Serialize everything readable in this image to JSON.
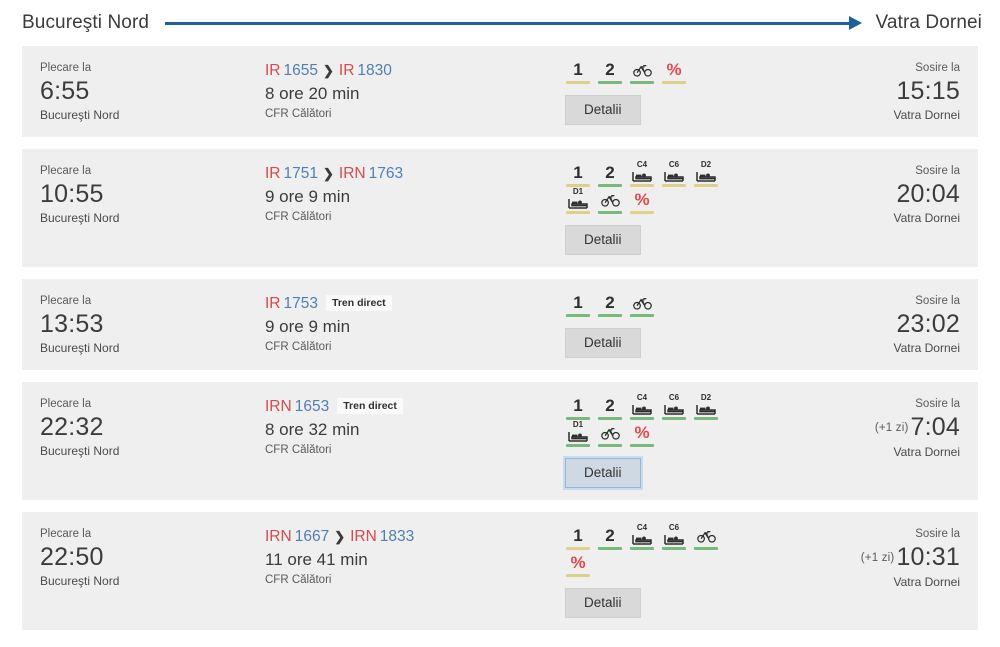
{
  "route": {
    "origin": "Bucureşti Nord",
    "destination": "Vatra Dornei",
    "arrow_color": "#1f5f9e"
  },
  "labels": {
    "depart": "Plecare la",
    "arrive": "Sosire la",
    "details_button": "Detalii",
    "direct_badge": "Tren direct",
    "next_day": "(+1 zi)"
  },
  "colors": {
    "card_bg": "#efefef",
    "page_bg": "#ffffff",
    "train_prefix": "#d84a4a",
    "train_number": "#4f7fb3",
    "percent": "#e24a4a",
    "bar_green": "#79b97e",
    "bar_khaki": "#ddd08a",
    "focus_ring": "#9bb6d4"
  },
  "results": [
    {
      "depart_label": "Plecare la",
      "depart_time": "6:55",
      "depart_station": "Bucureşti Nord",
      "legs": [
        {
          "prefix": "IR",
          "number": "1655"
        },
        {
          "prefix": "IR",
          "number": "1830"
        }
      ],
      "direct": false,
      "duration": "8 ore 20 min",
      "operator": "CFR Călători",
      "amenities": [
        {
          "icon": "class-1",
          "text": "1",
          "bar": "khaki"
        },
        {
          "icon": "class-2",
          "text": "2",
          "bar": "green"
        },
        {
          "icon": "bicycle-icon",
          "text": "",
          "bar": "green"
        },
        {
          "icon": "discount-percent-icon",
          "text": "%",
          "bar": "khaki"
        }
      ],
      "details_button": "Detalii",
      "details_focused": false,
      "arrive_label": "Sosire la",
      "arrive_nextday": "",
      "arrive_time": "15:15",
      "arrive_station": "Vatra Dornei"
    },
    {
      "depart_label": "Plecare la",
      "depart_time": "10:55",
      "depart_station": "Bucureşti Nord",
      "legs": [
        {
          "prefix": "IR",
          "number": "1751"
        },
        {
          "prefix": "IRN",
          "number": "1763"
        }
      ],
      "direct": false,
      "duration": "9 ore 9 min",
      "operator": "CFR Călători",
      "amenities": [
        {
          "icon": "class-1",
          "text": "1",
          "bar": "khaki"
        },
        {
          "icon": "class-2",
          "text": "2",
          "bar": "green"
        },
        {
          "icon": "couchette-c4-icon",
          "text": "C4",
          "bar": "khaki"
        },
        {
          "icon": "couchette-c6-icon",
          "text": "C6",
          "bar": "khaki"
        },
        {
          "icon": "sleeper-d2-icon",
          "text": "D2",
          "bar": "khaki"
        },
        {
          "icon": "sleeper-d1-icon",
          "text": "D1",
          "bar": "khaki"
        },
        {
          "icon": "bicycle-icon",
          "text": "",
          "bar": "green"
        },
        {
          "icon": "discount-percent-icon",
          "text": "%",
          "bar": "khaki"
        }
      ],
      "details_button": "Detalii",
      "details_focused": false,
      "arrive_label": "Sosire la",
      "arrive_nextday": "",
      "arrive_time": "20:04",
      "arrive_station": "Vatra Dornei"
    },
    {
      "depart_label": "Plecare la",
      "depart_time": "13:53",
      "depart_station": "Bucureşti Nord",
      "legs": [
        {
          "prefix": "IR",
          "number": "1753"
        }
      ],
      "direct": true,
      "duration": "9 ore 9 min",
      "operator": "CFR Călători",
      "amenities": [
        {
          "icon": "class-1",
          "text": "1",
          "bar": "green"
        },
        {
          "icon": "class-2",
          "text": "2",
          "bar": "green"
        },
        {
          "icon": "bicycle-icon",
          "text": "",
          "bar": "green"
        }
      ],
      "details_button": "Detalii",
      "details_focused": false,
      "arrive_label": "Sosire la",
      "arrive_nextday": "",
      "arrive_time": "23:02",
      "arrive_station": "Vatra Dornei"
    },
    {
      "depart_label": "Plecare la",
      "depart_time": "22:32",
      "depart_station": "Bucureşti Nord",
      "legs": [
        {
          "prefix": "IRN",
          "number": "1653"
        }
      ],
      "direct": true,
      "duration": "8 ore 32 min",
      "operator": "CFR Călători",
      "amenities": [
        {
          "icon": "class-1",
          "text": "1",
          "bar": "green"
        },
        {
          "icon": "class-2",
          "text": "2",
          "bar": "green"
        },
        {
          "icon": "couchette-c4-icon",
          "text": "C4",
          "bar": "green"
        },
        {
          "icon": "couchette-c6-icon",
          "text": "C6",
          "bar": "green"
        },
        {
          "icon": "sleeper-d2-icon",
          "text": "D2",
          "bar": "green"
        },
        {
          "icon": "sleeper-d1-icon",
          "text": "D1",
          "bar": "green"
        },
        {
          "icon": "bicycle-icon",
          "text": "",
          "bar": "green"
        },
        {
          "icon": "discount-percent-icon",
          "text": "%",
          "bar": "green"
        }
      ],
      "details_button": "Detalii",
      "details_focused": true,
      "arrive_label": "Sosire la",
      "arrive_nextday": "(+1 zi)",
      "arrive_time": "7:04",
      "arrive_station": "Vatra Dornei"
    },
    {
      "depart_label": "Plecare la",
      "depart_time": "22:50",
      "depart_station": "Bucureşti Nord",
      "legs": [
        {
          "prefix": "IRN",
          "number": "1667"
        },
        {
          "prefix": "IRN",
          "number": "1833"
        }
      ],
      "direct": false,
      "duration": "11 ore 41 min",
      "operator": "CFR Călători",
      "amenities": [
        {
          "icon": "class-1",
          "text": "1",
          "bar": "khaki"
        },
        {
          "icon": "class-2",
          "text": "2",
          "bar": "green"
        },
        {
          "icon": "couchette-c4-icon",
          "text": "C4",
          "bar": "green"
        },
        {
          "icon": "couchette-c6-icon",
          "text": "C6",
          "bar": "green"
        },
        {
          "icon": "bicycle-icon",
          "text": "",
          "bar": "green"
        },
        {
          "icon": "discount-percent-icon",
          "text": "%",
          "bar": "khaki"
        }
      ],
      "details_button": "Detalii",
      "details_focused": false,
      "arrive_label": "Sosire la",
      "arrive_nextday": "(+1 zi)",
      "arrive_time": "10:31",
      "arrive_station": "Vatra Dornei"
    }
  ]
}
